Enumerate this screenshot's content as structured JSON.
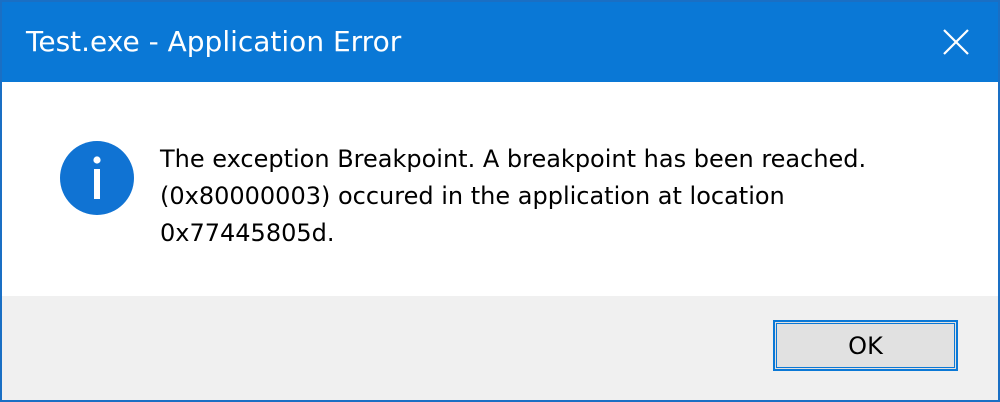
{
  "window": {
    "title": "Test.exe - Application Error",
    "accent_color": "#0a78d6",
    "close_icon": "close-icon"
  },
  "content": {
    "icon": "info-icon",
    "icon_color": "#1073d3",
    "message_lines": [
      "The exception Breakpoint. A breakpoint has been reached.",
      "(0x80000003) occured in the application at location",
      "0x77445805d."
    ]
  },
  "footer": {
    "ok_label": "OK"
  }
}
